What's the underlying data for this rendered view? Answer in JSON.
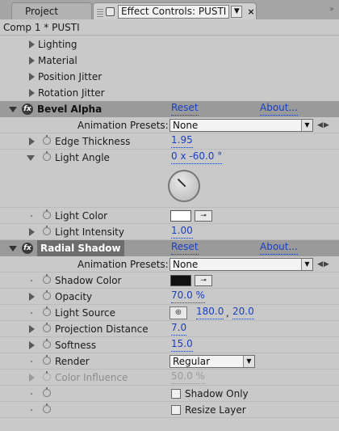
{
  "tabs": {
    "project": "Project",
    "effect_controls": "Effect Controls: PUSTI",
    "menu_glyph": "▼",
    "close_glyph": "×",
    "flyout_glyph": "»"
  },
  "comp_title": "Comp 1 * PUSTI",
  "top_groups": [
    "Lighting",
    "Material",
    "Position Jitter",
    "Rotation Jitter"
  ],
  "bevel_alpha": {
    "name": "Bevel Alpha",
    "reset": "Reset",
    "about": "About...",
    "presets_label": "Animation Presets:",
    "presets_value": "None",
    "edge_thickness_label": "Edge Thickness",
    "edge_thickness_value": "1.95",
    "light_angle_label": "Light Angle",
    "light_angle_value": "0 x -60.0 °",
    "light_color_label": "Light Color",
    "light_color": "#ffffff",
    "light_intensity_label": "Light Intensity",
    "light_intensity_value": "1.00"
  },
  "radial_shadow": {
    "name": "Radial Shadow",
    "reset": "Reset",
    "about": "About...",
    "presets_label": "Animation Presets:",
    "presets_value": "None",
    "shadow_color_label": "Shadow Color",
    "shadow_color": "#111111",
    "opacity_label": "Opacity",
    "opacity_value": "70.0 %",
    "light_source_label": "Light Source",
    "light_source_x": "180.0",
    "light_source_sep": ",",
    "light_source_y": "20.0",
    "projection_distance_label": "Projection Distance",
    "projection_distance_value": "7.0",
    "softness_label": "Softness",
    "softness_value": "15.0",
    "render_label": "Render",
    "render_value": "Regular",
    "color_influence_label": "Color Influence",
    "color_influence_value": "50.0 %",
    "shadow_only_label": "Shadow Only",
    "resize_layer_label": "Resize Layer"
  },
  "icons": {
    "fx": "fx-icon",
    "stopwatch": "stopwatch-icon",
    "eyedropper": "eyedropper-icon",
    "crosshair": "crosshair-icon"
  }
}
